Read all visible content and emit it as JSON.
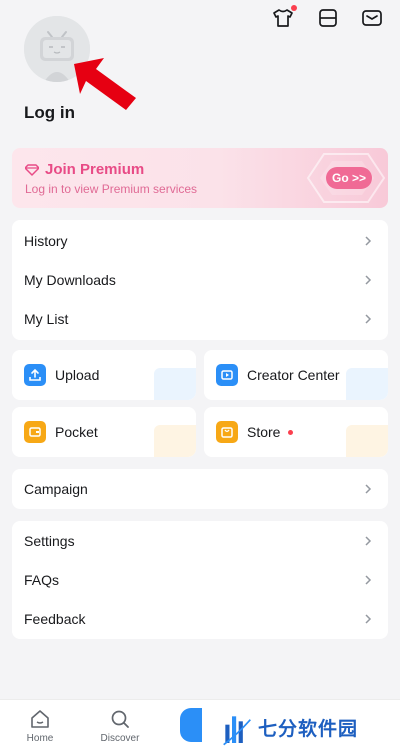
{
  "header": {
    "icons": [
      "shirt-icon",
      "scan-icon",
      "mail-icon"
    ],
    "notification_color": "#fb3f4e"
  },
  "profile": {
    "login_label": "Log in"
  },
  "premium": {
    "title": "Join Premium",
    "subtitle": "Log in to view Premium services",
    "go_label": "Go >>",
    "accent": "#e84b86"
  },
  "list1": {
    "items": [
      {
        "label": "History"
      },
      {
        "label": "My Downloads"
      },
      {
        "label": "My List"
      }
    ]
  },
  "tiles": [
    {
      "label": "Upload",
      "icon": "upload-icon",
      "color": "#2b8ff7"
    },
    {
      "label": "Creator Center",
      "icon": "creator-icon",
      "color": "#2b8ff7"
    },
    {
      "label": "Pocket",
      "icon": "wallet-icon",
      "color": "#f7a816"
    },
    {
      "label": "Store",
      "icon": "store-icon",
      "color": "#f7a816"
    }
  ],
  "list2": {
    "items": [
      {
        "label": "Campaign"
      }
    ]
  },
  "list3": {
    "items": [
      {
        "label": "Settings"
      },
      {
        "label": "FAQs"
      },
      {
        "label": "Feedback"
      }
    ]
  },
  "bottom_nav": {
    "items": [
      {
        "label": "Home",
        "icon": "home-icon"
      },
      {
        "label": "Discover",
        "icon": "discover-icon"
      }
    ]
  },
  "watermark": {
    "text": "七分软件园"
  }
}
